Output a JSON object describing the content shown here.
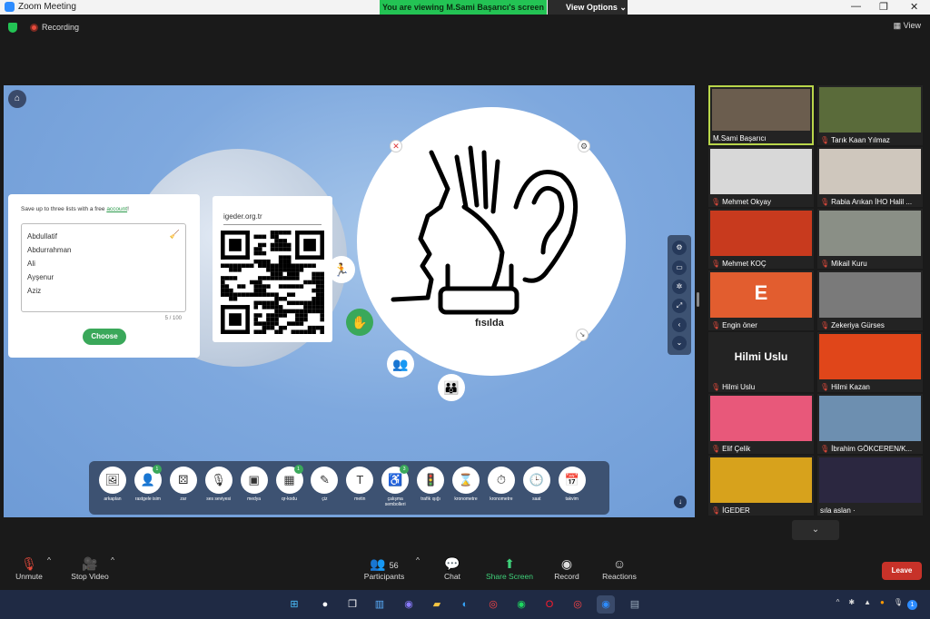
{
  "window": {
    "title": "Zoom Meeting"
  },
  "banner": {
    "viewing": "You are viewing M.Sami Başarıcı's screen",
    "view_options": "View Options"
  },
  "topbar": {
    "recording": "Recording",
    "view": "View"
  },
  "share": {
    "list_card": {
      "hint_prefix": "Save up to three lists with a free ",
      "hint_link": "account",
      "hint_suffix": "!",
      "items": [
        "Abdullatif",
        "Abdurrahman",
        "Ali",
        "Ayşenur",
        "Aziz"
      ],
      "count": "5 / 100",
      "choose": "Choose"
    },
    "qr_card": {
      "site": "igeder.org.tr"
    },
    "symbol": {
      "label": "fısılda"
    },
    "toolbar": [
      {
        "label": "arkaplan",
        "icon": "image-icon",
        "glyph": "🖼"
      },
      {
        "label": "rastgele isim",
        "icon": "person-icon",
        "glyph": "👤",
        "badge": "1"
      },
      {
        "label": "zar",
        "icon": "dice-icon",
        "glyph": "⚄"
      },
      {
        "label": "ses seviyesi",
        "icon": "mic-icon",
        "glyph": "🎙"
      },
      {
        "label": "medya",
        "icon": "media-icon",
        "glyph": "▣"
      },
      {
        "label": "qr-kodu",
        "icon": "qr-icon",
        "glyph": "▦",
        "badge": "1"
      },
      {
        "label": "çiz",
        "icon": "pencil-icon",
        "glyph": "✎"
      },
      {
        "label": "metin",
        "icon": "text-icon",
        "glyph": "T"
      },
      {
        "label": "çalışma sembolleri",
        "icon": "symbols-icon",
        "glyph": "♿",
        "badge": "3"
      },
      {
        "label": "trafik ışığı",
        "icon": "traffic-light-icon",
        "glyph": "🚦"
      },
      {
        "label": "kronometre",
        "icon": "hourglass-icon",
        "glyph": "⌛"
      },
      {
        "label": "kronometre",
        "icon": "stopwatch-icon",
        "glyph": "⏱"
      },
      {
        "label": "saat",
        "icon": "clock-icon",
        "glyph": "🕒"
      },
      {
        "label": "takvim",
        "icon": "calendar-icon",
        "glyph": "📅"
      }
    ]
  },
  "gallery": [
    {
      "name": "M.Sami Başarıcı",
      "muted": false,
      "active": true,
      "color": "#6b5d4e"
    },
    {
      "name": "Tarık Kaan Yılmaz",
      "muted": true,
      "color": "#5a6b3a"
    },
    {
      "name": "Mehmet Okyay",
      "muted": true,
      "color": "#d8d8d8"
    },
    {
      "name": "Rabia Arıkan İHO Halil ...",
      "muted": true,
      "color": "#cfc7bd"
    },
    {
      "name": "Mehmet KOÇ",
      "muted": true,
      "color": "#c83a1e"
    },
    {
      "name": "Mikail Kuru",
      "muted": true,
      "color": "#8a8f86"
    },
    {
      "name": "Engin öner",
      "muted": true,
      "color": "#e25d2f",
      "initial": "E"
    },
    {
      "name": "Zekeriya Gürses",
      "muted": true,
      "color": "#7a7a7a"
    },
    {
      "name": "Hilmi Uslu",
      "muted": true,
      "color": "#232323",
      "big": "Hilmi Uslu"
    },
    {
      "name": "Hilmi Kazan",
      "muted": true,
      "color": "#e0461a"
    },
    {
      "name": "Elif Çelik",
      "muted": true,
      "color": "#e8587a"
    },
    {
      "name": "İbrahim GÖKCEREN/K...",
      "muted": true,
      "color": "#6d8fb0"
    },
    {
      "name": "İGEDER",
      "muted": true,
      "color": "#d7a21c"
    },
    {
      "name": "sıla aslan ·",
      "muted": false,
      "color": "#2b2740"
    }
  ],
  "controls": {
    "unmute": "Unmute",
    "stop_video": "Stop Video",
    "participants": "Participants",
    "participants_count": "56",
    "chat": "Chat",
    "share_screen": "Share Screen",
    "record": "Record",
    "reactions": "Reactions",
    "leave": "Leave"
  },
  "colors": {
    "accent_green": "#23c354",
    "leave_red": "#c73229",
    "board_blue": "#7ea8de"
  }
}
